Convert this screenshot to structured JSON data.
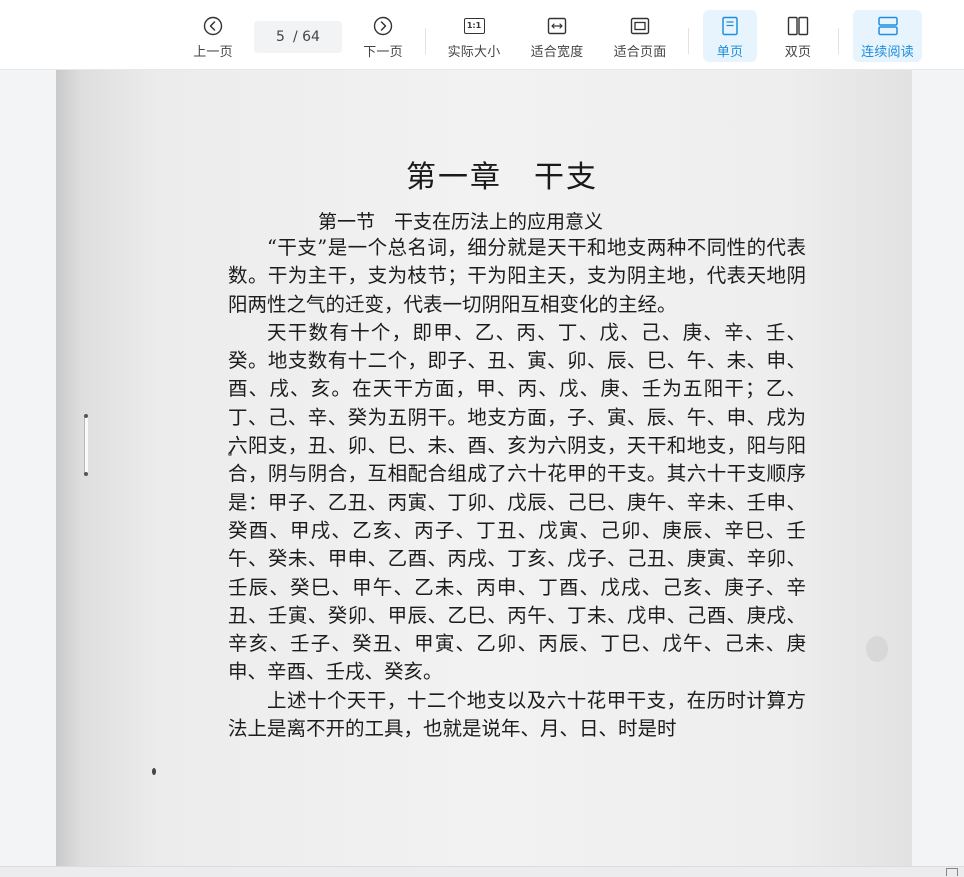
{
  "toolbar": {
    "prev_label": "上一页",
    "current_page": "5",
    "total_pages": "/ 64",
    "next_label": "下一页",
    "actual_size_label": "实际大小",
    "actual_size_glyph": "1:1",
    "fit_width_label": "适合宽度",
    "fit_page_label": "适合页面",
    "single_page_label": "单页",
    "double_page_label": "双页",
    "continuous_label": "连续阅读",
    "icons": [
      "chevron-left-circle-icon",
      "chevron-right-circle-icon",
      "actual-size-icon",
      "fit-width-icon",
      "fit-page-icon",
      "single-page-icon",
      "double-page-icon",
      "continuous-scroll-icon"
    ],
    "active_modes": [
      "single_page",
      "continuous"
    ],
    "accent_color": "#1f8fdc"
  },
  "document": {
    "chapter_title": "第一章　干支",
    "section_title": "第一节　干支在历法上的应用意义",
    "paragraphs": [
      "“干支”是一个总名词，细分就是天干和地支两种不同性的代表数。干为主干，支为枝节；干为阳主天，支为阴主地，代表天地阴阳两性之气的迁变，代表一切阴阳互相变化的主经。",
      "天干数有十个，即甲、乙、丙、丁、戊、己、庚、辛、壬、癸。地支数有十二个，即子、丑、寅、卯、辰、巳、午、未、申、酉、戌、亥。在天干方面，甲、丙、戊、庚、壬为五阳干；乙、丁、己、辛、癸为五阴干。地支方面，子、寅、辰、午、申、戌为六阳支，丑、卯、巳、未、酉、亥为六阴支，天干和地支，阳与阳合，阴与阴合，互相配合组成了六十花甲的干支。其六十干支顺序是：甲子、乙丑、丙寅、丁卯、戊辰、己巳、庚午、辛未、壬申、癸酉、甲戌、乙亥、丙子、丁丑、戊寅、己卯、庚辰、辛巳、壬午、癸未、甲申、乙酉、丙戌、丁亥、戊子、己丑、庚寅、辛卯、壬辰、癸巳、甲午、乙未、丙申、丁酉、戊戌、己亥、庚子、辛丑、壬寅、癸卯、甲辰、乙巳、丙午、丁未、戊申、己酉、庚戌、辛亥、壬子、癸丑、甲寅、乙卯、丙辰、丁巳、戊午、己未、庚申、辛酉、壬戌、癸亥。",
      "上述十个天干，十二个地支以及六十花甲干支，在历时计算方法上是离不开的工具，也就是说年、月、日、时是时"
    ]
  }
}
